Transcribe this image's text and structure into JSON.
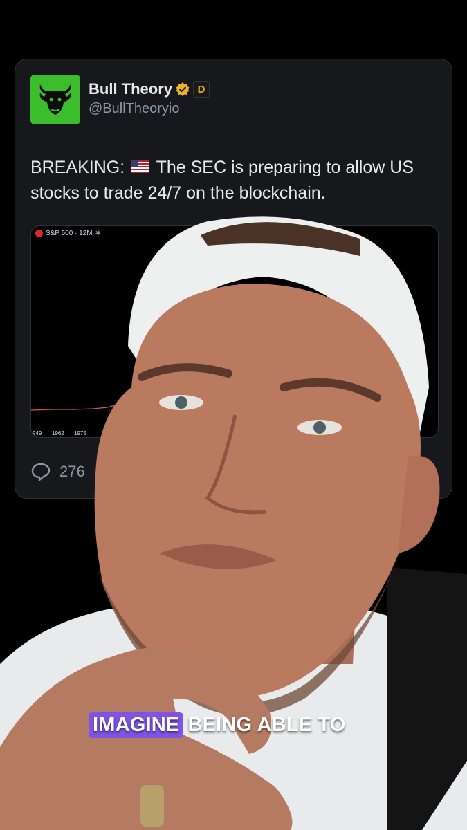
{
  "tweet": {
    "name": "Bull Theory",
    "handle": "@BullTheoryio",
    "verified_badge": "verified-gold-badge",
    "affiliate_badge_text": "D",
    "text_before_flag": "BREAKING:",
    "flag_icon": "us-flag-icon",
    "text_after_flag": "The SEC is preparing to allow US stocks to trade 24/7 on the blockchain.",
    "reply_count": "276",
    "avatar_color": "#3bbd2c"
  },
  "chart": {
    "symbol_label": "S&P 500 · 12M",
    "x_ticks": [
      "949",
      "1962",
      "1975"
    ]
  },
  "caption": {
    "highlighted_word": "IMAGINE",
    "rest": "BEING ABLE TO",
    "highlight_color": "#7f54e4"
  }
}
